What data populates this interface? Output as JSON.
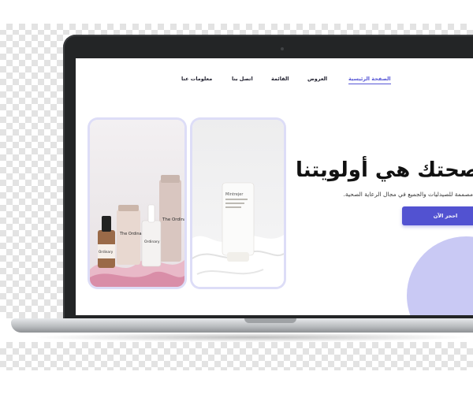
{
  "nav": {
    "items": [
      {
        "label": "الصفحة الرئيسية",
        "active": true
      },
      {
        "label": "العروض",
        "active": false
      },
      {
        "label": "القائمة",
        "active": false
      },
      {
        "label": "اتصل بنا",
        "active": false
      },
      {
        "label": "معلومات عنا",
        "active": false
      }
    ]
  },
  "hero": {
    "title": "صحتك هي أولويتنا",
    "subtitle": "مصممة للصيدليات والجميع في مجال الرعاية الصحية.",
    "cta_label": "احجز الآن"
  },
  "products": {
    "left_brand": "The Ordinary.",
    "left_brand_short": "Ordinary",
    "right_tube_text": "Mintrejer"
  },
  "colors": {
    "accent": "#5252d1",
    "accent_light": "#c9c9f4",
    "laptop_frame": "#232526"
  },
  "icons": {
    "laptop": "laptop-mockup"
  }
}
